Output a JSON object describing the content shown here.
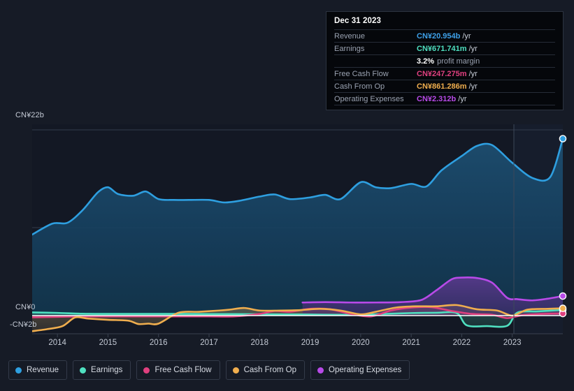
{
  "axes": {
    "y_top_label": "CN¥22b",
    "y_zero_label": "CN¥0",
    "y_neg_label": "-CN¥2b",
    "x_labels": [
      "2014",
      "2015",
      "2016",
      "2017",
      "2018",
      "2019",
      "2020",
      "2021",
      "2022",
      "2023"
    ]
  },
  "tooltip": {
    "date": "Dec 31 2023",
    "unit": "/yr",
    "rows": [
      {
        "label": "Revenue",
        "value": "CN¥20.954b",
        "unit": "/yr",
        "color_key": "c-rev"
      },
      {
        "label": "Earnings",
        "value": "CN¥671.741m",
        "unit": "/yr",
        "color_key": "c-ear"
      },
      {
        "label": "",
        "value": "3.2%",
        "unit": "",
        "sub": "profit margin",
        "color_key": "c-white"
      },
      {
        "label": "Free Cash Flow",
        "value": "CN¥247.275m",
        "unit": "/yr",
        "color_key": "c-fcf"
      },
      {
        "label": "Cash From Op",
        "value": "CN¥861.286m",
        "unit": "/yr",
        "color_key": "c-cfo"
      },
      {
        "label": "Operating Expenses",
        "value": "CN¥2.312b",
        "unit": "/yr",
        "color_key": "c-opex"
      }
    ]
  },
  "legend": {
    "items": [
      {
        "label": "Revenue",
        "color": "#2e9fe0"
      },
      {
        "label": "Earnings",
        "color": "#4fe0c0"
      },
      {
        "label": "Free Cash Flow",
        "color": "#e0407f"
      },
      {
        "label": "Cash From Op",
        "color": "#f0ae4e"
      },
      {
        "label": "Operating Expenses",
        "color": "#b84ae8"
      }
    ]
  },
  "chart_data": {
    "type": "area",
    "title": "",
    "xlabel": "",
    "ylabel": "CN¥",
    "currency": "CN¥",
    "period": "/yr",
    "ylim": [
      -2,
      22
    ],
    "y_ticks": [
      22,
      0,
      -2
    ],
    "grid": true,
    "legend_position": "bottom",
    "x_range": [
      "2013-06",
      "2023-12"
    ],
    "x_tick_years": [
      2014,
      2015,
      2016,
      2017,
      2018,
      2019,
      2020,
      2021,
      2022,
      2023
    ],
    "forecast_divider_year": 2023.0,
    "series": [
      {
        "name": "Revenue",
        "color": "#2e9fe0",
        "unit": "b",
        "last_value": 20.954,
        "x": [
          2013.5,
          2013.9,
          2014.2,
          2014.5,
          2014.8,
          2015.0,
          2015.2,
          2015.5,
          2015.75,
          2016.0,
          2016.3,
          2016.6,
          2017.0,
          2017.3,
          2017.6,
          2018.0,
          2018.3,
          2018.6,
          2019.0,
          2019.3,
          2019.6,
          2020.0,
          2020.3,
          2020.6,
          2021.0,
          2021.3,
          2021.6,
          2022.0,
          2022.3,
          2022.6,
          2023.0,
          2023.4,
          2023.75,
          2024.0
        ],
        "y": [
          9.6,
          10.9,
          11.0,
          12.5,
          14.6,
          15.2,
          14.4,
          14.2,
          14.7,
          13.8,
          13.7,
          13.7,
          13.7,
          13.4,
          13.6,
          14.1,
          14.35,
          13.8,
          14.0,
          14.3,
          13.8,
          15.8,
          15.2,
          15.1,
          15.6,
          15.3,
          17.2,
          18.9,
          20.1,
          20.2,
          18.1,
          16.3,
          16.4,
          20.954
        ]
      },
      {
        "name": "Earnings",
        "color": "#4fe0c0",
        "unit": "m",
        "last_value": 671.741,
        "x": [
          2013.5,
          2014.0,
          2014.5,
          2015.0,
          2015.5,
          2016.0,
          2016.5,
          2017.0,
          2017.5,
          2018.0,
          2018.5,
          2019.0,
          2019.5,
          2020.0,
          2020.5,
          2021.0,
          2021.5,
          2021.9,
          2022.1,
          2022.5,
          2022.9,
          2023.1,
          2023.5,
          2024.0
        ],
        "y": [
          0.38,
          0.32,
          0.22,
          0.2,
          0.2,
          0.2,
          0.2,
          0.18,
          0.18,
          0.16,
          0.14,
          0.13,
          0.1,
          0.1,
          0.2,
          0.3,
          0.34,
          0.3,
          -1.15,
          -1.25,
          -1.2,
          0.35,
          0.5,
          0.672
        ]
      },
      {
        "name": "Free Cash Flow",
        "color": "#e0407f",
        "unit": "m",
        "last_value": 247.275,
        "x": [
          2013.5,
          2014.0,
          2014.5,
          2015.0,
          2015.5,
          2016.0,
          2016.5,
          2017.0,
          2017.5,
          2018.0,
          2018.3,
          2018.6,
          2019.0,
          2019.4,
          2019.8,
          2020.2,
          2020.6,
          2021.0,
          2021.4,
          2021.8,
          2022.2,
          2022.6,
          2022.9,
          2023.2,
          2023.6,
          2024.0
        ],
        "y": [
          -0.2,
          -0.15,
          -0.1,
          -0.1,
          -0.1,
          -0.1,
          -0.1,
          -0.1,
          -0.1,
          0.2,
          0.55,
          0.45,
          0.8,
          0.75,
          0.2,
          -0.1,
          0.6,
          0.95,
          1.0,
          0.55,
          0.2,
          0.1,
          -0.3,
          0.05,
          0.2,
          0.247
        ]
      },
      {
        "name": "Cash From Op",
        "color": "#f0ae4e",
        "unit": "m",
        "last_value": 861.286,
        "x": [
          2013.5,
          2013.8,
          2014.1,
          2014.35,
          2014.6,
          2015.0,
          2015.4,
          2015.6,
          2015.8,
          2016.0,
          2016.4,
          2016.8,
          2017.2,
          2017.4,
          2017.7,
          2018.0,
          2018.4,
          2018.8,
          2019.2,
          2019.6,
          2020.0,
          2020.3,
          2020.7,
          2021.1,
          2021.5,
          2021.9,
          2022.3,
          2022.7,
          2023.0,
          2023.3,
          2023.7,
          2024.0
        ],
        "y": [
          -1.85,
          -1.6,
          -1.25,
          -0.22,
          -0.35,
          -0.5,
          -0.6,
          -1.0,
          -0.95,
          -0.95,
          0.35,
          0.45,
          0.6,
          0.7,
          0.9,
          0.6,
          0.6,
          0.65,
          0.8,
          0.6,
          0.15,
          0.45,
          0.95,
          1.1,
          1.1,
          1.25,
          0.75,
          0.6,
          0.0,
          0.7,
          0.8,
          0.861
        ]
      },
      {
        "name": "Operating Expenses",
        "color": "#b84ae8",
        "unit": "b",
        "last_value": 2.312,
        "x": [
          2018.85,
          2019.3,
          2019.8,
          2020.3,
          2020.8,
          2021.2,
          2021.5,
          2021.8,
          2022.0,
          2022.3,
          2022.6,
          2022.9,
          2023.1,
          2023.4,
          2023.7,
          2024.0
        ],
        "y": [
          1.55,
          1.6,
          1.55,
          1.55,
          1.6,
          1.85,
          3.0,
          4.3,
          4.5,
          4.45,
          3.9,
          2.1,
          1.95,
          1.8,
          2.0,
          2.312
        ]
      }
    ]
  }
}
